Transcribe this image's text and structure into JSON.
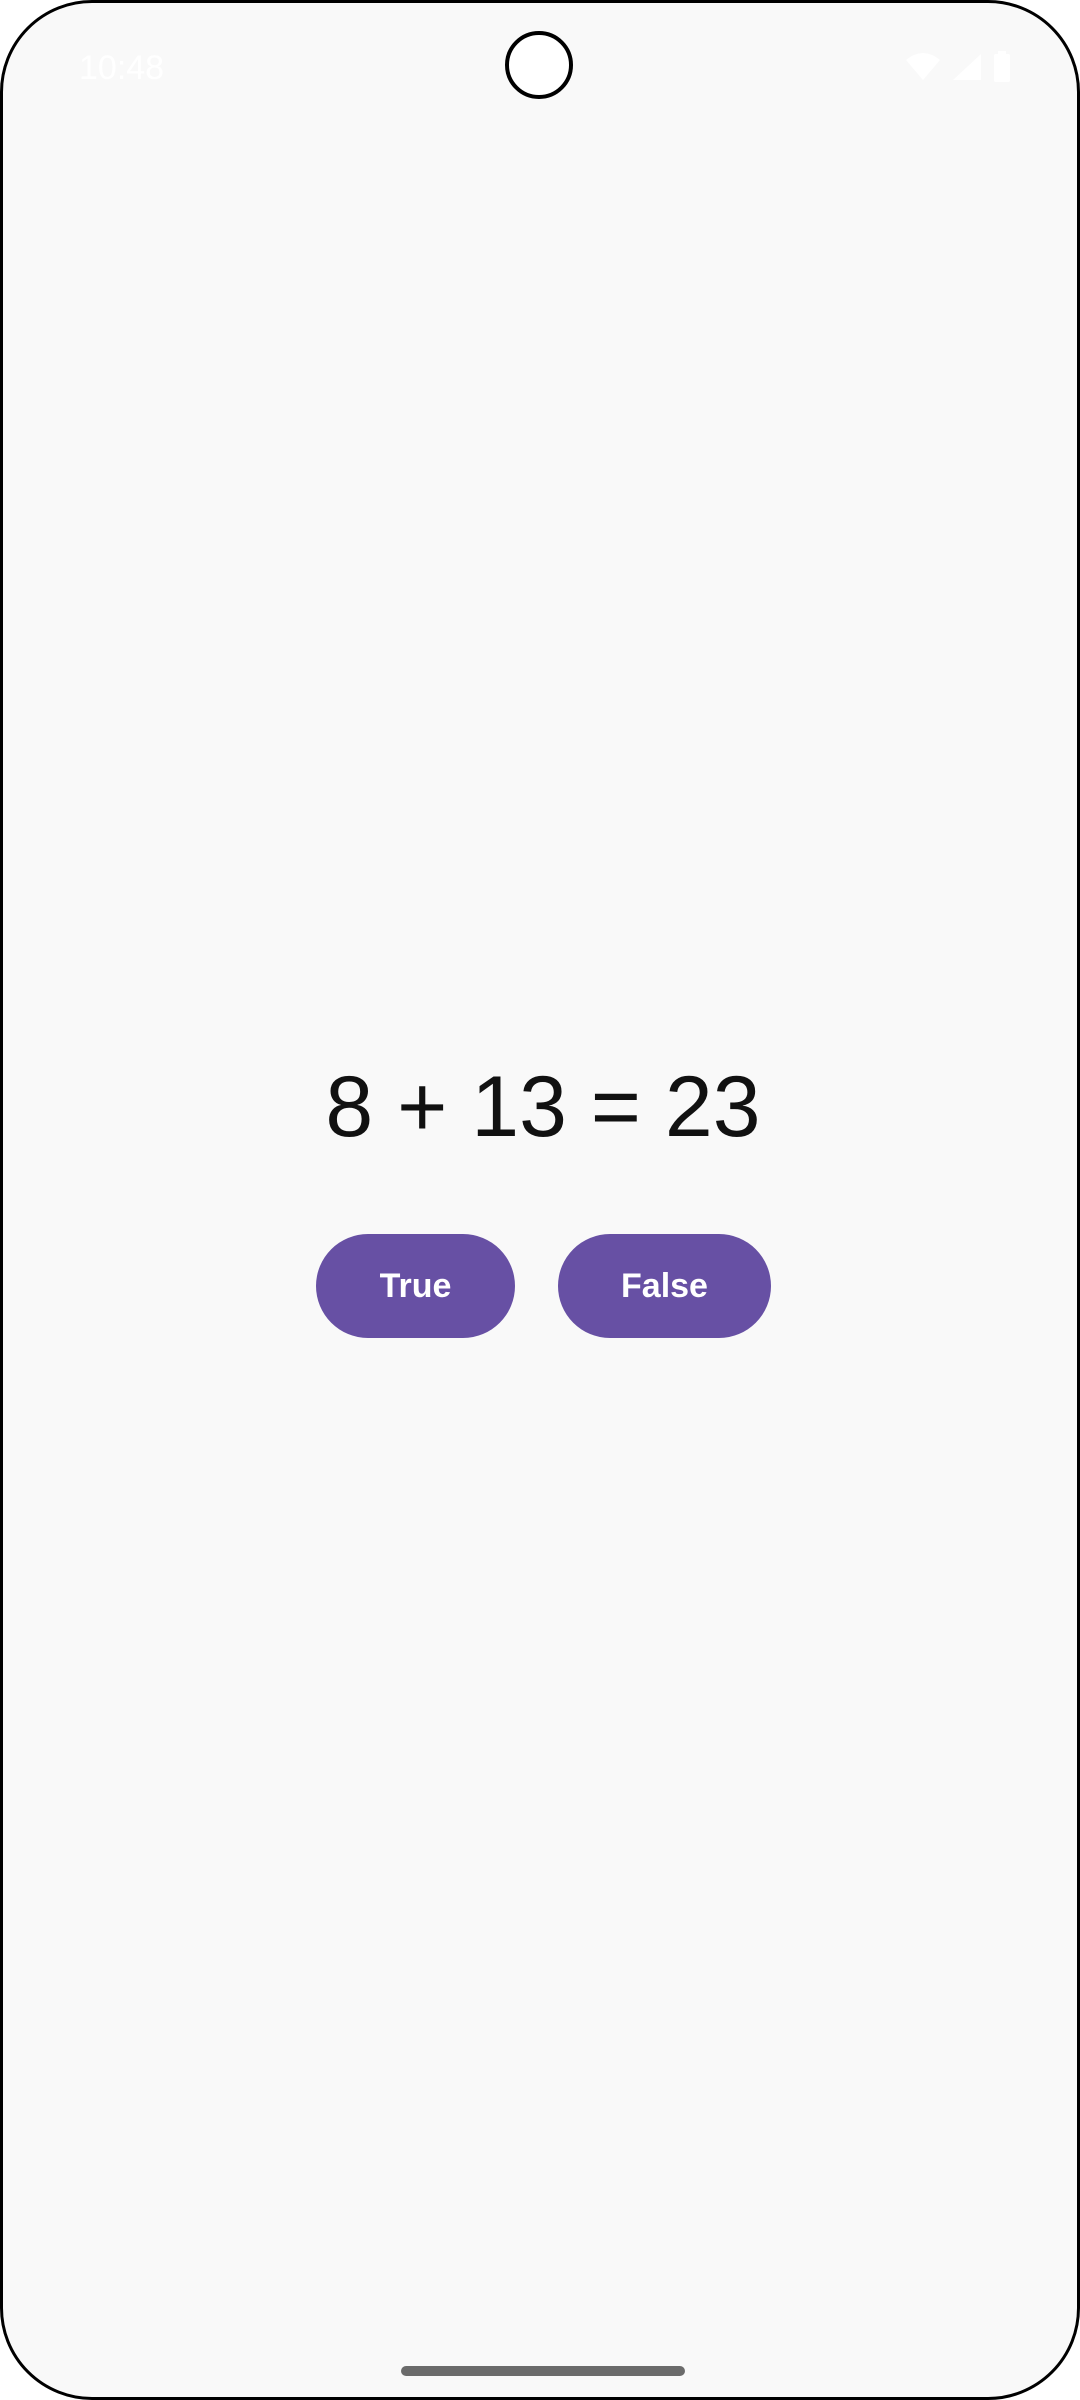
{
  "status_bar": {
    "time": "10:48",
    "icons": [
      "wifi-icon",
      "signal-icon",
      "battery-icon"
    ]
  },
  "quiz": {
    "equation": "8 + 13 = 23",
    "true_label": "True",
    "false_label": "False"
  },
  "colors": {
    "accent": "#6750a4",
    "background": "#f9f9f9"
  }
}
